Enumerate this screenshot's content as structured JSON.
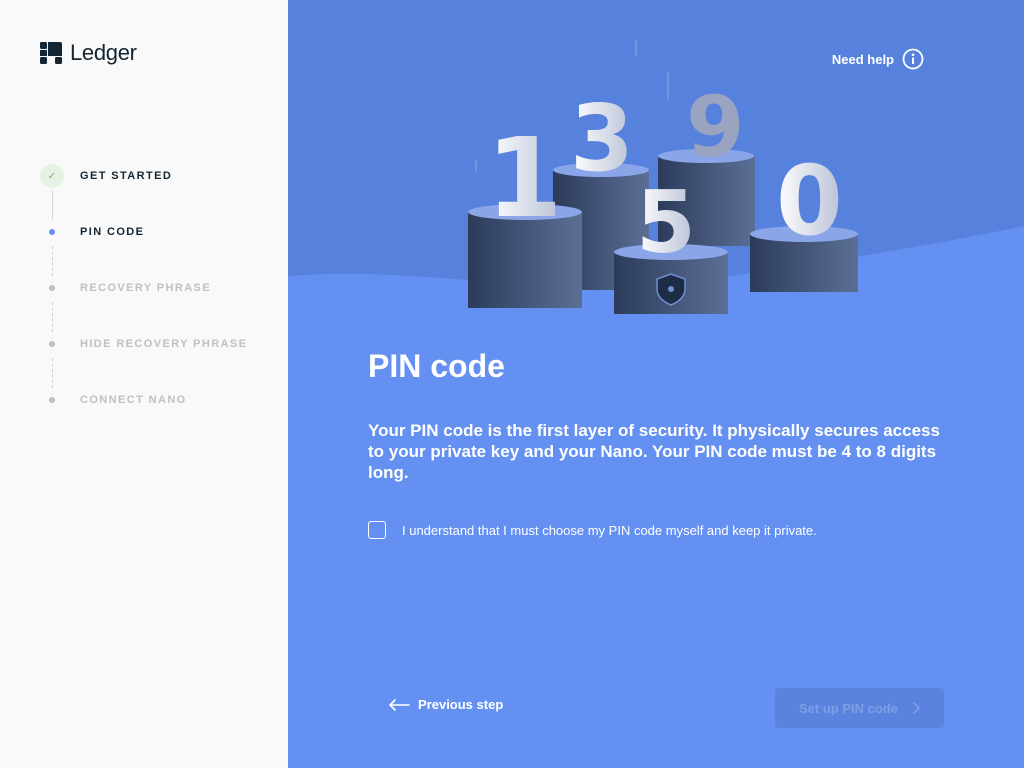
{
  "app": {
    "logo_text": "Ledger"
  },
  "sidebar": {
    "steps": [
      {
        "label": "GET STARTED",
        "state": "done"
      },
      {
        "label": "PIN CODE",
        "state": "active"
      },
      {
        "label": "RECOVERY PHRASE",
        "state": "pending"
      },
      {
        "label": "HIDE RECOVERY PHRASE",
        "state": "pending"
      },
      {
        "label": "CONNECT NANO",
        "state": "pending"
      }
    ],
    "check_glyph": "✓"
  },
  "header": {
    "help_label": "Need help",
    "help_icon": "info-icon"
  },
  "illustration": {
    "digits": [
      "1",
      "3",
      "9",
      "5",
      "0"
    ]
  },
  "main": {
    "title": "PIN code",
    "description": "Your PIN code is the first layer of security. It physically secures access to your private key and your Nano. Your PIN code must be 4 to 8 digits long.",
    "checkbox_label": "I understand that I must choose my PIN code myself and keep it private.",
    "checkbox_checked": false
  },
  "footer": {
    "prev_label": "Previous step",
    "next_label": "Set up PIN code",
    "next_enabled": false
  },
  "colors": {
    "accent": "#6490f1",
    "dark": "#142533",
    "success": "#66be54"
  }
}
